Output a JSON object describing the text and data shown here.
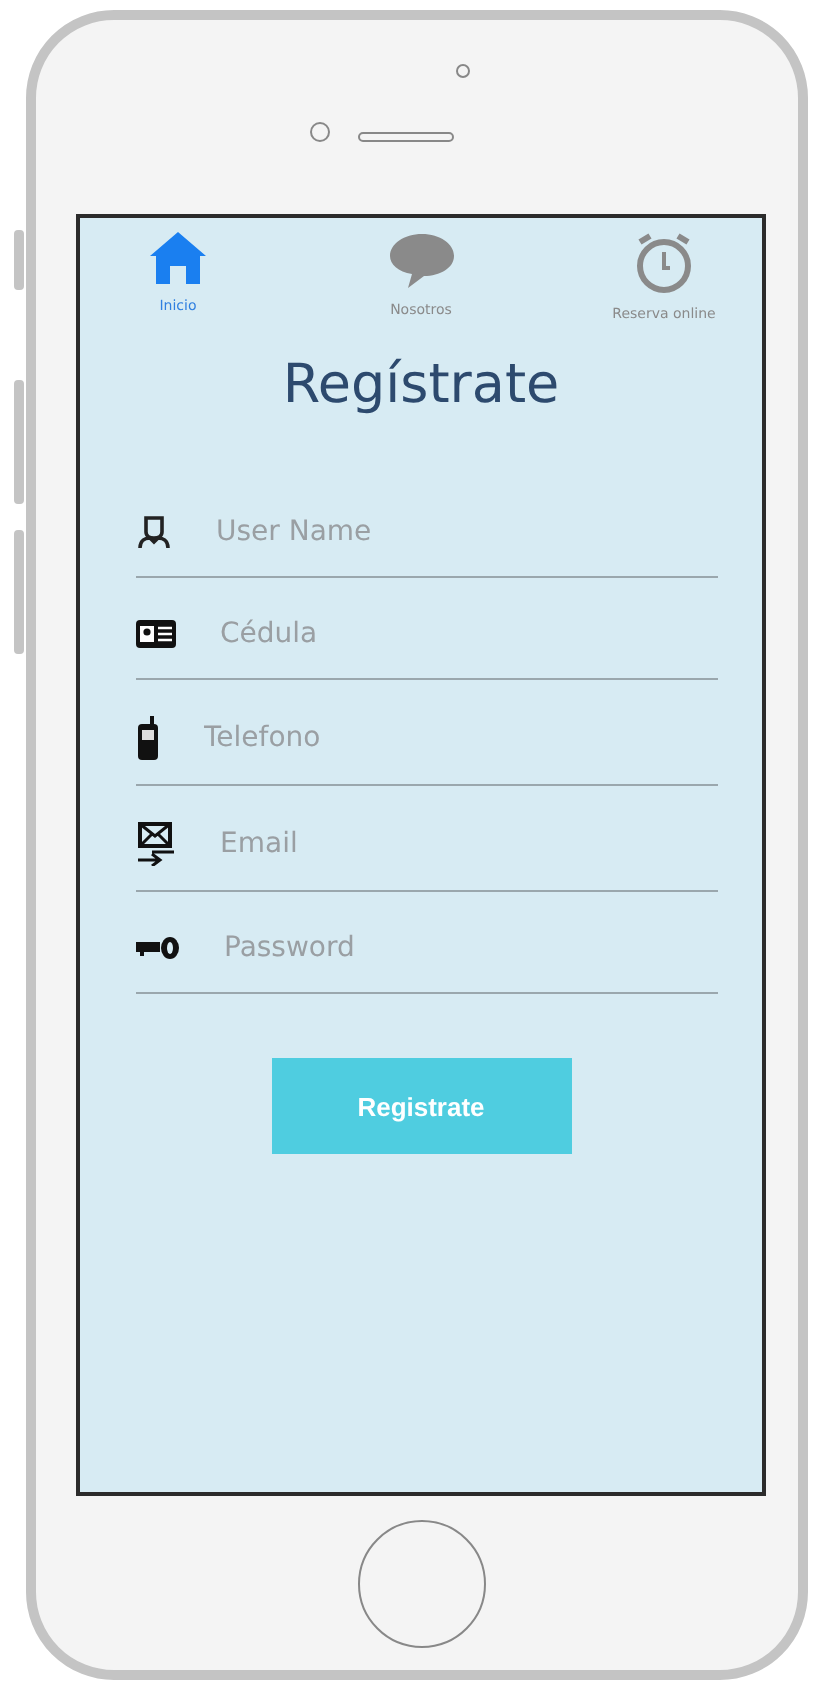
{
  "nav": [
    {
      "kind": "home",
      "label": "Inicio",
      "selected": true
    },
    {
      "kind": "chat",
      "label": "Nosotros",
      "selected": false
    },
    {
      "kind": "timer",
      "label": "Reserva online",
      "selected": false
    }
  ],
  "title": "Regístrate",
  "fields": [
    {
      "kind": "user",
      "placeholder": "User Name"
    },
    {
      "kind": "id-card",
      "placeholder": "Cédula"
    },
    {
      "kind": "phone",
      "placeholder": "Telefono"
    },
    {
      "kind": "email",
      "placeholder": "Email"
    },
    {
      "kind": "key",
      "placeholder": "Password"
    }
  ],
  "submit": "Registrate"
}
